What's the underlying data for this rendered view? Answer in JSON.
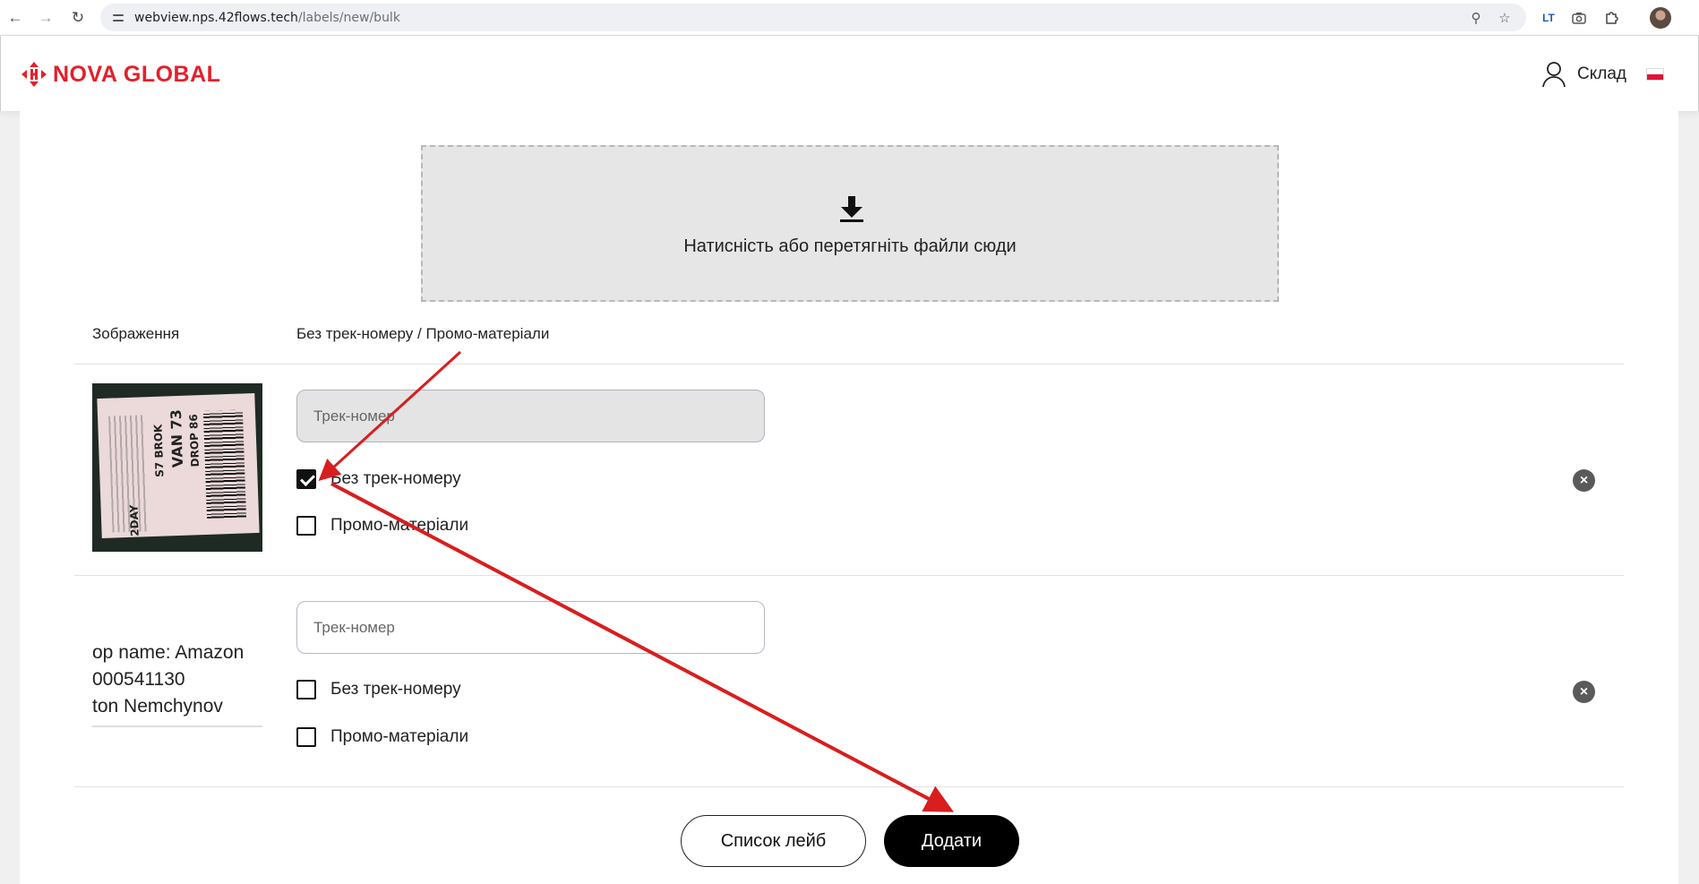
{
  "browser": {
    "url_host": "webview.nps.42flows.tech",
    "url_path": "/labels/new/bulk",
    "translate_label": "LT"
  },
  "header": {
    "logo_text": "NOVA GLOBAL",
    "user_role": "Склад"
  },
  "dropzone": {
    "text": "Натисність або перетягніть файли сюди"
  },
  "columns": {
    "image": "Зображення",
    "options": "Без трек-номеру / Промо-матеріали"
  },
  "rows": [
    {
      "thumbnail_text": [
        "S7 BROK",
        "VAN 73",
        "DROP 86",
        "2DAY"
      ],
      "track_placeholder": "Трек-номер",
      "track_disabled": true,
      "no_track_label": "Без трек-номеру",
      "no_track_checked": true,
      "promo_label": "Промо-матеріали",
      "promo_checked": false
    },
    {
      "thumbnail_text": [
        "op name: Amazon",
        "000541130",
        "ton Nemchynov"
      ],
      "track_placeholder": "Трек-номер",
      "track_disabled": false,
      "no_track_label": "Без трек-номеру",
      "no_track_checked": false,
      "promo_label": "Промо-матеріали",
      "promo_checked": false
    }
  ],
  "actions": {
    "list_label": "Список лейб",
    "add_label": "Додати"
  },
  "colors": {
    "brand": "#e3202a",
    "annotation_arrow": "#d81e1e",
    "primary_button": "#000000"
  }
}
